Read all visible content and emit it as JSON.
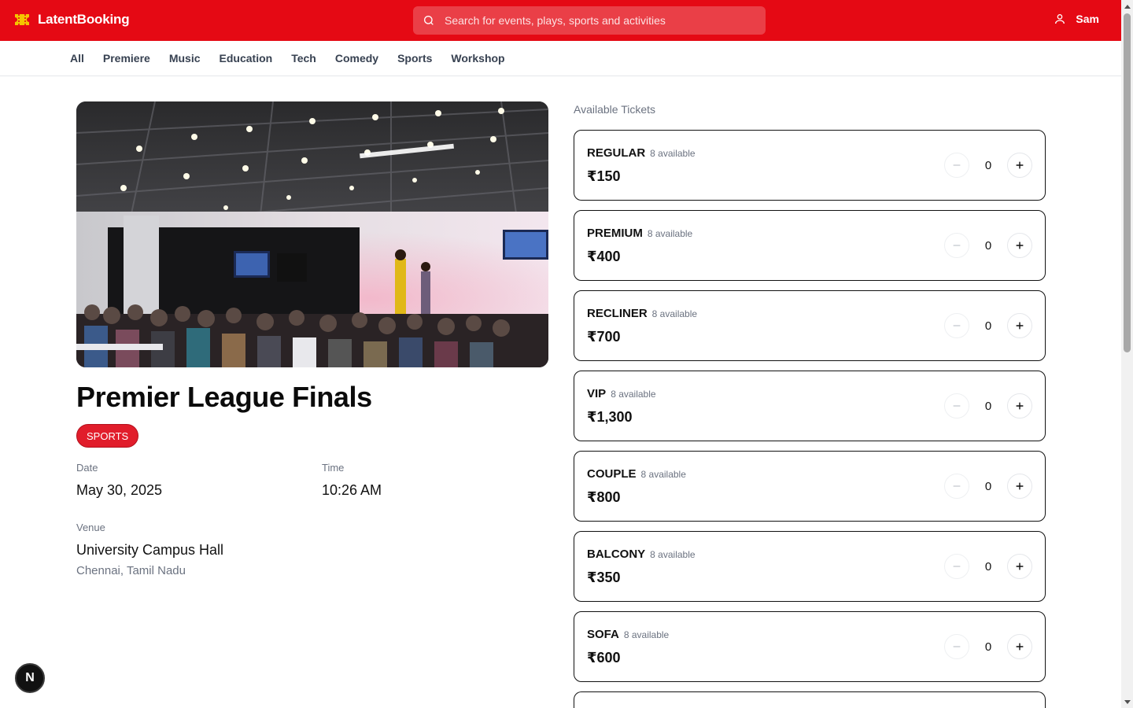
{
  "header": {
    "brand": "LatentBooking",
    "search_placeholder": "Search for events, plays, sports and activities",
    "user_name": "Sam",
    "brand_color": "#e50914"
  },
  "categories": [
    "All",
    "Premiere",
    "Music",
    "Education",
    "Tech",
    "Comedy",
    "Sports",
    "Workshop"
  ],
  "event": {
    "title": "Premier League Finals",
    "badge": "SPORTS",
    "date_label": "Date",
    "date": "May 30, 2025",
    "time_label": "Time",
    "time": "10:26 AM",
    "venue_label": "Venue",
    "venue": "University Campus Hall",
    "city": "Chennai, Tamil Nadu"
  },
  "tickets_label": "Available Tickets",
  "tickets": [
    {
      "name": "REGULAR",
      "available": "8 available",
      "price": "₹150",
      "qty": "0"
    },
    {
      "name": "PREMIUM",
      "available": "8 available",
      "price": "₹400",
      "qty": "0"
    },
    {
      "name": "RECLINER",
      "available": "8 available",
      "price": "₹700",
      "qty": "0"
    },
    {
      "name": "VIP",
      "available": "8 available",
      "price": "₹1,300",
      "qty": "0"
    },
    {
      "name": "COUPLE",
      "available": "8 available",
      "price": "₹800",
      "qty": "0"
    },
    {
      "name": "BALCONY",
      "available": "8 available",
      "price": "₹350",
      "qty": "0"
    },
    {
      "name": "SOFA",
      "available": "8 available",
      "price": "₹600",
      "qty": "0"
    }
  ],
  "fab_label": "N"
}
